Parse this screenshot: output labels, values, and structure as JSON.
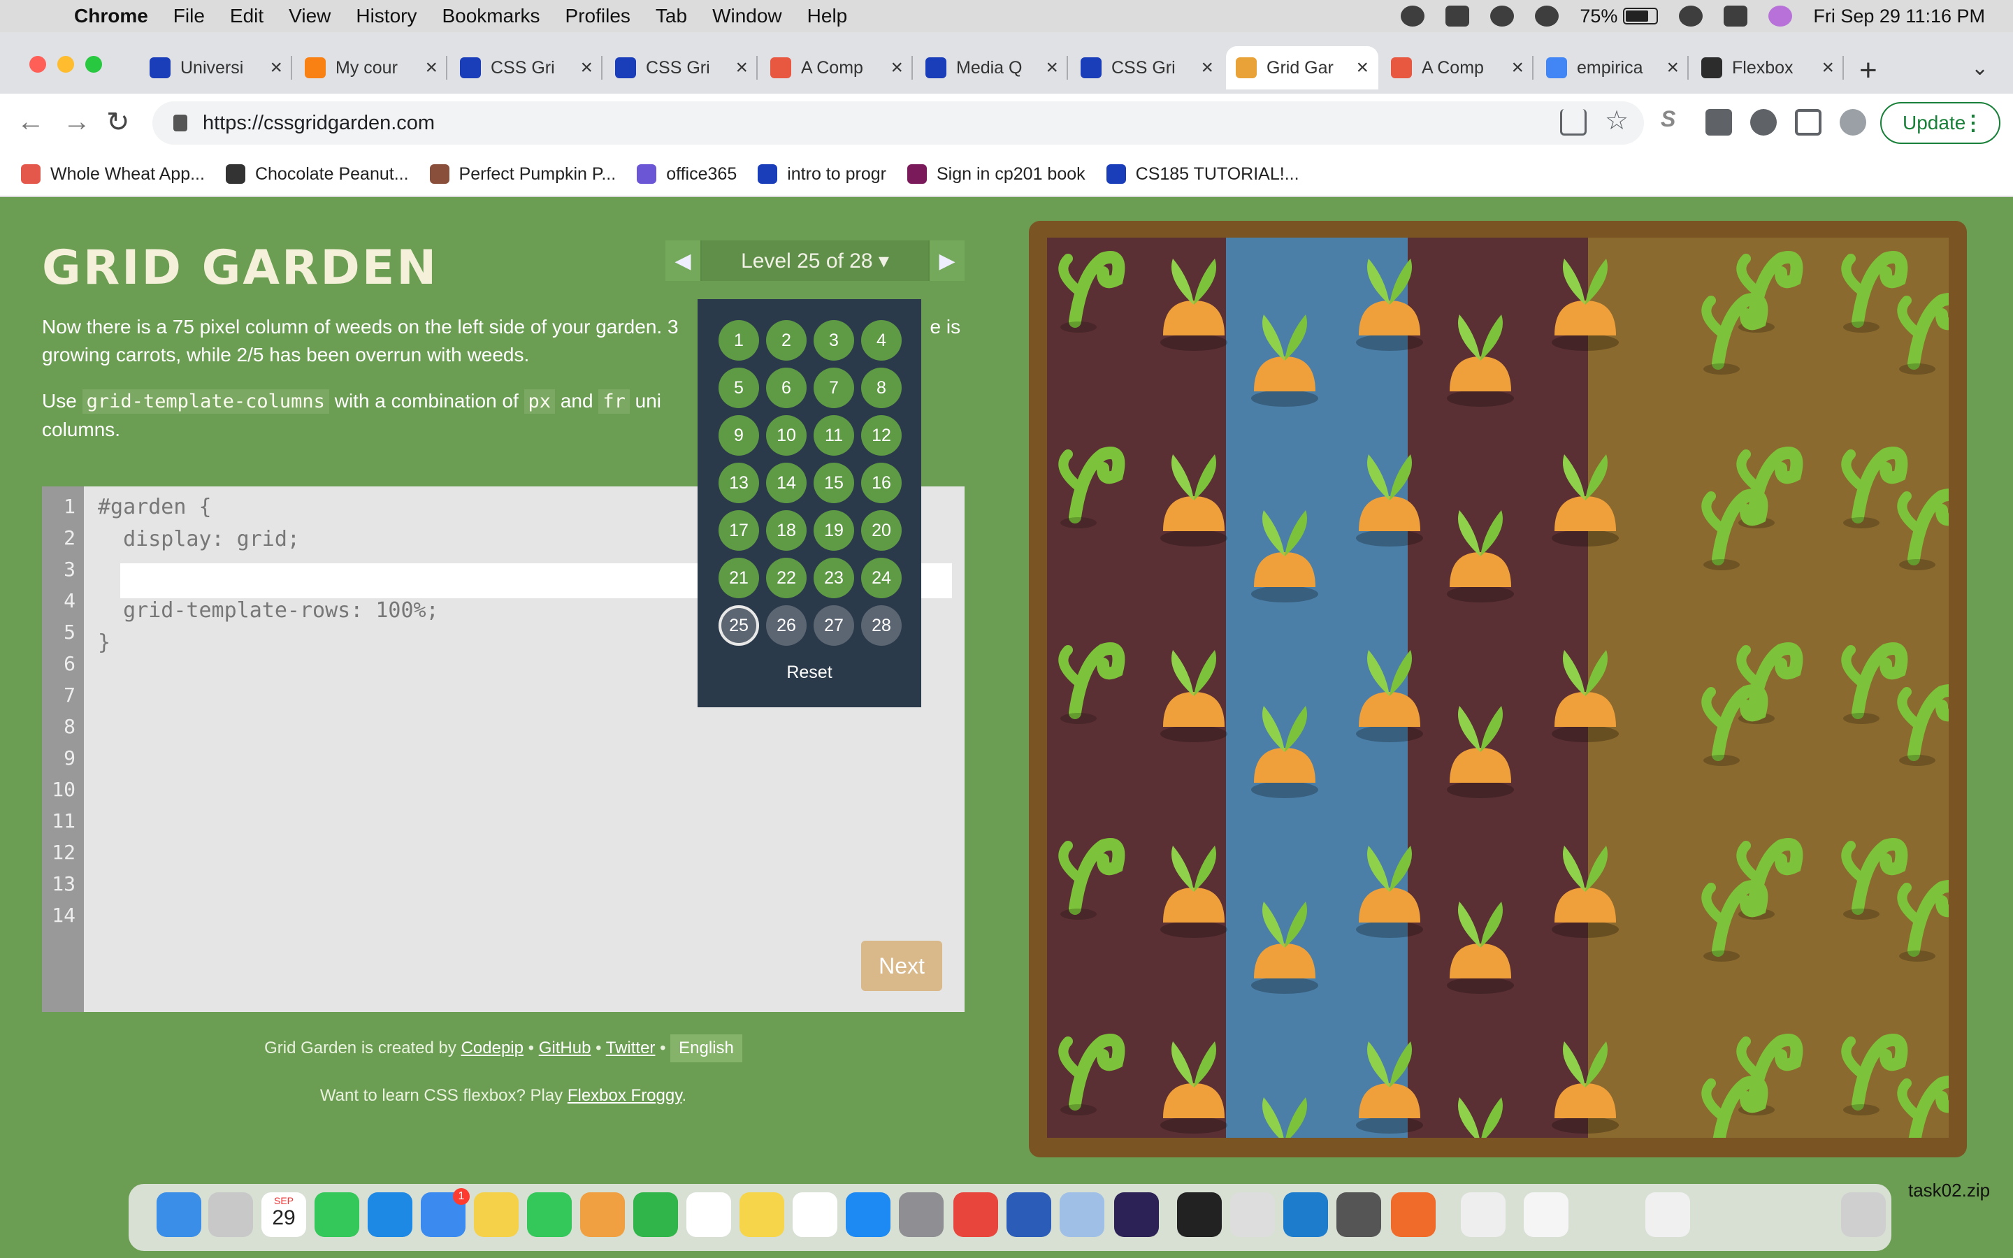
{
  "menubar": {
    "apple": "",
    "items": [
      "Chrome",
      "File",
      "Edit",
      "View",
      "History",
      "Bookmarks",
      "Profiles",
      "Tab",
      "Window",
      "Help"
    ],
    "battery": "75%",
    "battery_level": 0.75,
    "datetime": "Fri Sep 29  11:16 PM"
  },
  "tabs": [
    {
      "title": "Universi",
      "icon": "autodesk-icon",
      "color": "#1a3dba"
    },
    {
      "title": "My cour",
      "icon": "moodle-icon",
      "color": "#f98012"
    },
    {
      "title": "CSS Gri",
      "icon": "css-tricks-icon",
      "color": "#1a3dba"
    },
    {
      "title": "CSS Gri",
      "icon": "css-tricks-icon",
      "color": "#1a3dba"
    },
    {
      "title": "A Comp",
      "icon": "asterisk-icon",
      "color": "#e8573f"
    },
    {
      "title": "Media Q",
      "icon": "css-tricks-icon",
      "color": "#1a3dba"
    },
    {
      "title": "CSS Gri",
      "icon": "css-tricks-icon",
      "color": "#1a3dba"
    },
    {
      "title": "Grid Gar",
      "icon": "carrot-icon",
      "color": "#e8a238"
    },
    {
      "title": "A Comp",
      "icon": "asterisk-icon",
      "color": "#e8573f"
    },
    {
      "title": "empirica",
      "icon": "google-icon",
      "color": "#4285f4"
    },
    {
      "title": "Flexbox",
      "icon": "frog-icon",
      "color": "#2c2c2c"
    }
  ],
  "new_tab": "+",
  "url": "https://cssgridgarden.com",
  "update_label": "Update",
  "bookmarks": [
    {
      "label": "Whole Wheat App...",
      "color": "#e4574b"
    },
    {
      "label": "Chocolate Peanut...",
      "color": "#333333"
    },
    {
      "label": "Perfect Pumpkin P...",
      "color": "#8a4f3b"
    },
    {
      "label": "office365",
      "color": "#6b57d6"
    },
    {
      "label": "intro to progr",
      "color": "#1a3dba"
    },
    {
      "label": "Sign in cp201 book",
      "color": "#7a1a5b"
    },
    {
      "label": "CS185 TUTORIAL!...",
      "color": "#1a3dba"
    }
  ],
  "game": {
    "title": "GRID GARDEN",
    "level_text": "Level 25 of 28 ▾",
    "prev": "◀",
    "next": "▶",
    "instruction_1": "Now there is a 75 pixel column of weeds on the left side of your garden. 3",
    "instruction_1_tail": "e is",
    "instruction_1b": "growing carrots, while 2/5 has been overrun with weeds.",
    "instruction_2_a": "Use ",
    "instruction_2_code1": "grid-template-columns",
    "instruction_2_b": " with a combination of ",
    "instruction_2_code2": "px",
    "instruction_2_c": " and ",
    "instruction_2_code3": "fr",
    "instruction_2_d": " uni",
    "instruction_2e": "columns.",
    "code_lines": [
      "#garden {",
      "  display: grid;",
      "",
      "  grid-template-rows: 100%;",
      "}"
    ],
    "line_numbers": [
      "1",
      "2",
      "3",
      "4",
      "5",
      "6",
      "7",
      "8",
      "9",
      "10",
      "11",
      "12",
      "13",
      "14"
    ],
    "next_button": "Next",
    "footer_prefix": "Grid Garden is created by ",
    "footer_codepip": "Codepip",
    "footer_github": "GitHub",
    "footer_twitter": "Twitter",
    "footer_sep": " • ",
    "footer_lang": "English",
    "footer2_prefix": "Want to learn CSS flexbox? Play ",
    "footer2_link": "Flexbox Froggy",
    "footer2_suffix": "."
  },
  "level_dropdown": {
    "levels": [
      "1",
      "2",
      "3",
      "4",
      "5",
      "6",
      "7",
      "8",
      "9",
      "10",
      "11",
      "12",
      "13",
      "14",
      "15",
      "16",
      "17",
      "18",
      "19",
      "20",
      "21",
      "22",
      "23",
      "24",
      "25",
      "26",
      "27",
      "28"
    ],
    "current": "25",
    "reset": "Reset"
  },
  "dock": {
    "calendar_month": "SEP",
    "calendar_day": "29",
    "mail_badge": "1",
    "label": "task02.zip"
  }
}
